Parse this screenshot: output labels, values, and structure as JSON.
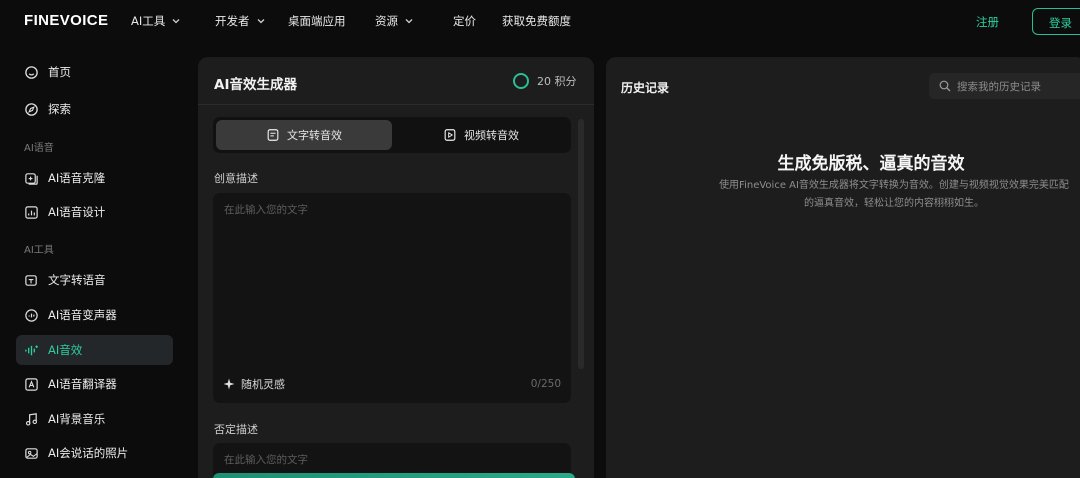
{
  "brand": {
    "logo": "FINEVOICE",
    "accent": "#2ccf9f"
  },
  "nav": {
    "items": [
      {
        "label": "AI工具",
        "dropdown": true
      },
      {
        "label": "开发者",
        "dropdown": true
      },
      {
        "label": "桌面端应用",
        "dropdown": false
      },
      {
        "label": "资源",
        "dropdown": true
      },
      {
        "label": "定价",
        "dropdown": false
      },
      {
        "label": "获取免费额度",
        "dropdown": false
      }
    ],
    "register": "注册",
    "login": "登录"
  },
  "sidebar": {
    "home": "首页",
    "explore": "探索",
    "section_voice": "AI语音",
    "voice_clone": "AI语音克隆",
    "voice_design": "AI语音设计",
    "section_tools": "AI工具",
    "tts": "文字转语音",
    "voice_changer": "AI语音变声器",
    "sound_effects": "AI音效",
    "translator": "AI语音翻译器",
    "bgm": "AI背景音乐",
    "talking_photo": "AI会说话的照片",
    "active": "AI音效"
  },
  "generator": {
    "title": "AI音效生成器",
    "credits": "20 积分",
    "tab_text": "文字转音效",
    "tab_video": "视频转音效",
    "prompt_label": "创意描述",
    "prompt_placeholder": "在此输入您的文字",
    "inspire": "随机灵感",
    "counter": "0/250",
    "negative_label": "否定描述",
    "negative_placeholder": "在此输入您的文字"
  },
  "history": {
    "title": "历史记录",
    "search_placeholder": "搜索我的历史记录",
    "empty_title": "生成免版税、逼真的音效",
    "empty_desc": "使用FineVoice AI音效生成器将文字转换为音效。创建与视频视觉效果完美匹配的逼真音效，轻松让您的内容栩栩如生。"
  }
}
